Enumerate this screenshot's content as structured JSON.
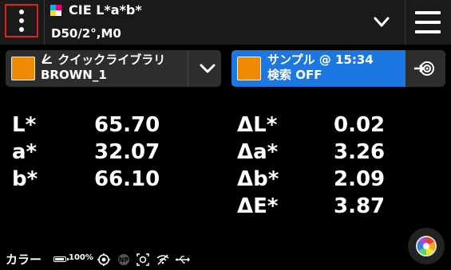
{
  "header": {
    "color_space": "CIE L*a*b*",
    "illuminant": "D50/2°,M0"
  },
  "library": {
    "name": "クイックライブラリ",
    "color_name": "BROWN_1",
    "swatch_color": "#ee8a00"
  },
  "sample": {
    "title": "サンプル @ 15:34",
    "search_label": "検索 OFF",
    "swatch_color": "#ee8a00",
    "accent": "#1c78e0"
  },
  "measurements": {
    "L": {
      "label": "L*",
      "value": "65.70"
    },
    "a": {
      "label": "a*",
      "value": "32.07"
    },
    "b": {
      "label": "b*",
      "value": "66.10"
    }
  },
  "deltas": {
    "dL": {
      "label": "ΔL*",
      "value": "0.02"
    },
    "da": {
      "label": "Δa*",
      "value": "3.26"
    },
    "db": {
      "label": "Δb*",
      "value": "2.09"
    },
    "dE": {
      "label": "ΔE*",
      "value": "3.87"
    }
  },
  "status": {
    "mode": "カラー",
    "battery_percent": 100,
    "battery_text": "100%",
    "icons": [
      "target-icon",
      "np-icon",
      "aperture-icon",
      "wifi-off-icon",
      "usb-icon"
    ]
  }
}
